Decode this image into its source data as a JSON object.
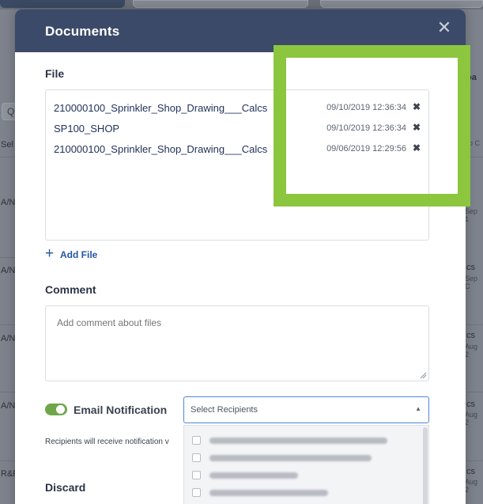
{
  "background": {
    "left_search_glyph": "Q",
    "left_partial": [
      "Sel",
      "A/N",
      "A/N",
      "A/N",
      "A/N",
      "R&F"
    ],
    "right_partial_title": "oa",
    "right_partial": [
      {
        "label": "s",
        "sub": "ep C"
      },
      {
        "label": "s",
        "sub": "Sep 1"
      },
      {
        "label": "cs",
        "sub": "Sep C"
      },
      {
        "label": "cs",
        "sub": "Aug 2"
      },
      {
        "label": "cs",
        "sub": "Aug 2"
      },
      {
        "label": "cs",
        "sub": "Aug 2"
      }
    ]
  },
  "modal": {
    "title": "Documents",
    "close_glyph": "✕",
    "file_section_label": "File",
    "files": [
      {
        "name": "210000100_Sprinkler_Shop_Drawing___Calcs",
        "date": "09/10/2019 12:36:34"
      },
      {
        "name": "SP100_SHOP",
        "date": "09/10/2019 12:36:34"
      },
      {
        "name": "210000100_Sprinkler_Shop_Drawing___Calcs",
        "date": "09/06/2019 12:29:56"
      }
    ],
    "remove_glyph": "✖",
    "add_file": {
      "icon": "+",
      "label": "Add File"
    },
    "comment_section_label": "Comment",
    "comment_placeholder": "Add comment about files",
    "email_notification": {
      "label": "Email Notification",
      "enabled": true
    },
    "recipients": {
      "placeholder": "Select Recipients",
      "caret": "▲",
      "note": "Recipients will receive notification v"
    },
    "discard_label": "Discard"
  },
  "colors": {
    "header": "#3a4a68",
    "toggle_on": "#6fa64a",
    "link": "#2456a6",
    "highlight": "#8cc63f"
  }
}
